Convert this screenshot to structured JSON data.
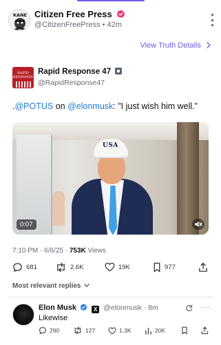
{
  "post": {
    "author_name": "Citizen Free Press",
    "author_handle": "@CitizenFreePress",
    "time_ago": "42m",
    "avatar_text": "KANE",
    "view_details": "View Truth Details"
  },
  "quote": {
    "name": "Rapid Response 47",
    "handle": "@RapidResponse47",
    "avatar_text_1": "RAPID",
    "avatar_text_2": "RESPONSE",
    "text_prefix": ".",
    "mention_1": "@POTUS",
    "text_mid": " on ",
    "mention_2": "@elonmusk",
    "text_suffix": ": \"I just wish him well.\""
  },
  "video": {
    "duration": "0:07",
    "cap_text": "USA"
  },
  "meta": {
    "time": "7:10 PM",
    "date": "6/6/25",
    "views_count": "753K",
    "views_label": "Views"
  },
  "actions": {
    "replies": "681",
    "retruths": "2.6K",
    "likes": "19K",
    "saves": "977"
  },
  "sort_label": "Most relevant replies",
  "reply": {
    "name": "Elon Musk",
    "x_badge": "X",
    "handle": "@elonmusk",
    "time_ago": "8m",
    "text": "Likewise",
    "more": "···",
    "replies": "290",
    "retruths": "127",
    "likes": "1.3K",
    "views": "20K"
  },
  "colors": {
    "accent": "#6d5ce8",
    "link": "#1d7bd8",
    "verified_pink": "#e8357a",
    "verified_blue": "#2c7be5"
  }
}
